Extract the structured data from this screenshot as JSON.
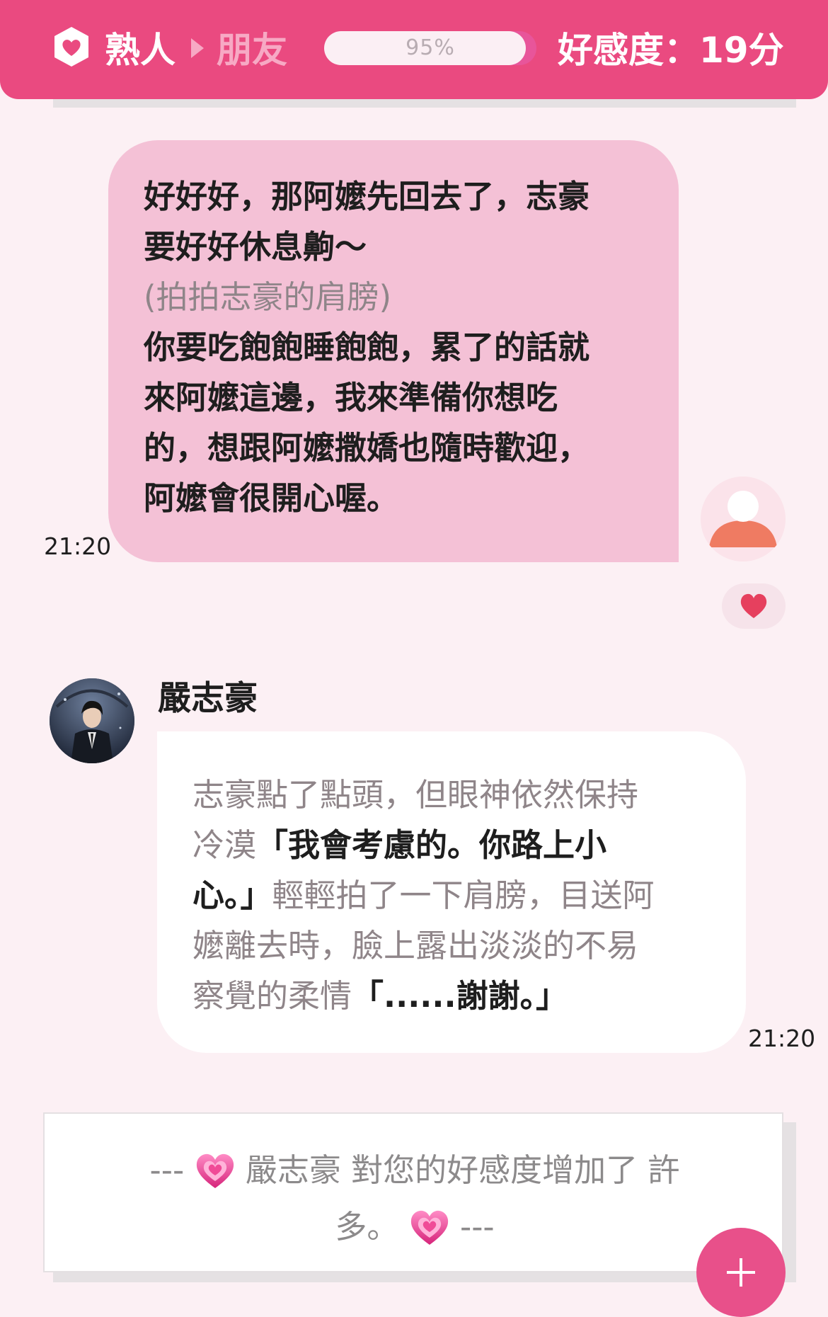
{
  "header": {
    "stage_from": "熟人",
    "stage_to": "朋友",
    "progress_percent": 95,
    "progress_label": "95%",
    "score_label": "好感度：19分",
    "accent_color": "#ea4a80"
  },
  "user_message": {
    "lines": [
      {
        "text": "好好好，那阿嬤先回去了，志豪",
        "style": "speech"
      },
      {
        "text": "要好好休息齁～",
        "style": "speech"
      },
      {
        "text": "(拍拍志豪的肩膀)",
        "style": "action"
      },
      {
        "text": "你要吃飽飽睡飽飽，累了的話就",
        "style": "speech"
      },
      {
        "text": "來阿嬤這邊，我來準備你想吃",
        "style": "speech"
      },
      {
        "text": "的，想跟阿嬤撒嬌也隨時歡迎，",
        "style": "speech"
      },
      {
        "text": "阿嬤會很開心喔。",
        "style": "speech"
      }
    ],
    "time": "21:20",
    "avatar_icon": "user-avatar-icon",
    "reaction_icon": "heart-icon"
  },
  "character_message": {
    "name": "嚴志豪",
    "lines": [
      [
        {
          "text": "志豪點了點頭，但眼神依然保持",
          "style": "narration"
        }
      ],
      [
        {
          "text": "冷漠",
          "style": "narration"
        },
        {
          "text": "「我會考慮的。你路上小",
          "style": "speech"
        }
      ],
      [
        {
          "text": "心。」",
          "style": "speech"
        },
        {
          "text": "輕輕拍了一下肩膀，目送阿",
          "style": "narration"
        }
      ],
      [
        {
          "text": "嬤離去時，臉上露出淡淡的不易",
          "style": "narration"
        }
      ],
      [
        {
          "text": "察覺的柔情",
          "style": "narration"
        },
        {
          "text": "「......謝謝。」",
          "style": "speech"
        }
      ]
    ],
    "time": "21:20"
  },
  "notice": {
    "line1_prefix": "---",
    "line1_text": "嚴志豪 對您的好感度增加了 許",
    "line2_text": "多。",
    "line2_suffix": "---",
    "icon": "pink-heart-icon"
  },
  "fab": {
    "icon": "plus-icon"
  }
}
